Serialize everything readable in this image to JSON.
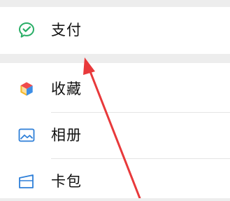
{
  "menu": {
    "pay": {
      "label": "支付",
      "icon": "wechat-pay-icon"
    },
    "items": [
      {
        "label": "收藏",
        "icon": "favorites-cube-icon"
      },
      {
        "label": "相册",
        "icon": "album-picture-icon"
      },
      {
        "label": "卡包",
        "icon": "card-wallet-icon"
      }
    ]
  },
  "colors": {
    "background": "#ededed",
    "card": "#ffffff",
    "pay_green": "#2aae67",
    "album_blue": "#2e7fd8",
    "annotation_red": "#e8393b"
  },
  "annotation": {
    "type": "arrow",
    "target": "pay-row"
  }
}
